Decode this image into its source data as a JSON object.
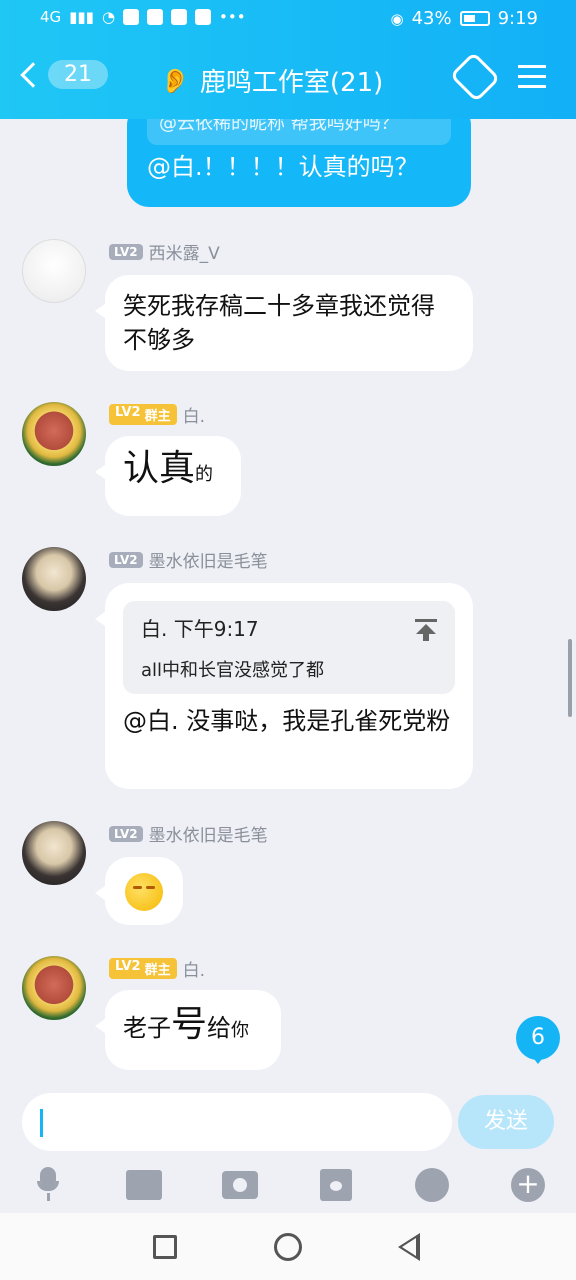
{
  "status_bar": {
    "network": "4G",
    "battery_percent": "43%",
    "time": "9:19"
  },
  "header": {
    "unread_count": "21",
    "group_title": "鹿鸣工作室(21)"
  },
  "messages": {
    "own_quote": "@云依稀的昵称 帮我鸣好吗？",
    "own_text": "@白.！！！！认真的吗？",
    "m1": {
      "level": "LV2",
      "sender": "西米露_V",
      "text": "笑死我存稿二十多章我还觉得不够多"
    },
    "m2": {
      "level": "LV2",
      "role": "群主",
      "sender": "白.",
      "text_big": "认真",
      "text_small": "的"
    },
    "m3": {
      "level": "LV2",
      "sender": "墨水依旧是毛笔",
      "quote_head": "白. 下午9:17",
      "quote_body": "all中和长官没感觉了都",
      "text": "@白. 没事哒，我是孔雀死党粉"
    },
    "m4": {
      "level": "LV2",
      "sender": "墨水依旧是毛笔",
      "emoji": "sleepy-face"
    },
    "m5": {
      "level": "LV2",
      "role": "群主",
      "sender": "白.",
      "text_a": "老子",
      "text_big": "号",
      "text_b": "给",
      "text_c": "你"
    }
  },
  "unread_badge": "6",
  "input": {
    "value": "",
    "placeholder": ""
  },
  "send_label": "发送",
  "colors": {
    "accent": "#15b4f5",
    "owner_badge": "#f6c238",
    "level_badge": "#a7adbb"
  }
}
